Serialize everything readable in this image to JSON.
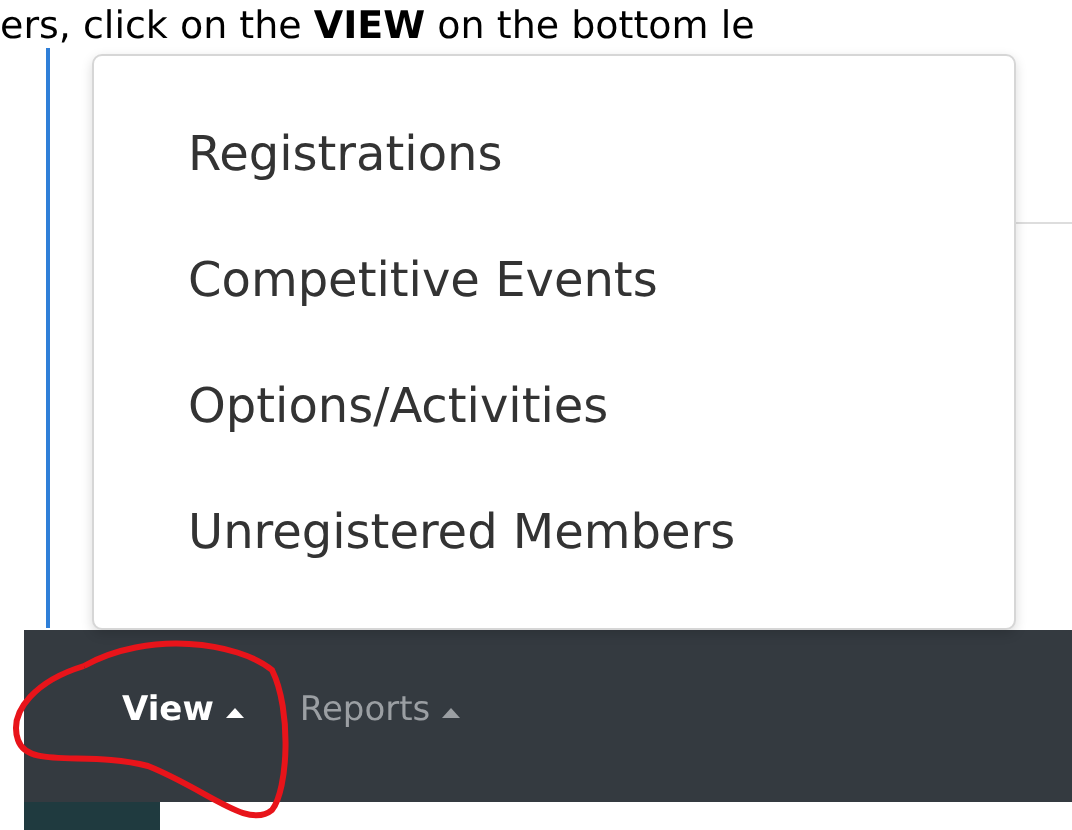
{
  "instruction": "ers, click on the **VIEW** on the bottom le",
  "menu": {
    "items": [
      {
        "label": "Registrations"
      },
      {
        "label": "Competitive Events"
      },
      {
        "label": "Options/Activities"
      },
      {
        "label": "Unregistered Members"
      }
    ]
  },
  "bottom_bar": {
    "items": [
      {
        "label": "View",
        "selected": true
      },
      {
        "label": "Reports",
        "selected": false
      }
    ]
  }
}
